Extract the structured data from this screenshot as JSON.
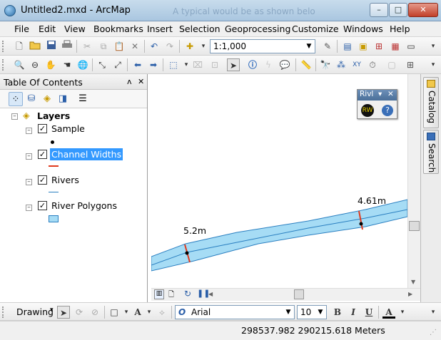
{
  "window": {
    "title": "Untitled2.mxd - ArcMap",
    "background_text": "A typical would be as shown belo",
    "minimize": "–",
    "maximize": "□",
    "close": "✕"
  },
  "menu": [
    "File",
    "Edit",
    "View",
    "Bookmarks",
    "Insert",
    "Selection",
    "Geoprocessing",
    "Customize",
    "Windows",
    "Help"
  ],
  "standard_toolbar": {
    "scale": "1:1,000"
  },
  "toc": {
    "title": "Table Of Contents",
    "pin": "ᴧ",
    "close": "✕",
    "root": "Layers",
    "layers": [
      {
        "name": "Sample",
        "checked": true,
        "symbol": "point"
      },
      {
        "name": "Channel Widths",
        "checked": true,
        "symbol": "line-red",
        "selected": true
      },
      {
        "name": "Rivers",
        "checked": true,
        "symbol": "line-blue"
      },
      {
        "name": "River Polygons",
        "checked": true,
        "symbol": "polygon"
      }
    ]
  },
  "map": {
    "labels": [
      {
        "text": "5.2m"
      },
      {
        "text": "4.61m"
      }
    ],
    "colors": {
      "river_fill": "#a6dcf5",
      "river_outline": "#2a7fc0",
      "centerline": "#2a7fc0",
      "width_line": "#e03a1e"
    }
  },
  "floating_toolbar": {
    "title": "Rivl",
    "dropdown": "▾",
    "close": "✕"
  },
  "right_dock": {
    "tabs": [
      "Catalog",
      "Search"
    ]
  },
  "drawing": {
    "label": "Drawing",
    "font": "Arial",
    "size": "10",
    "bold": "B",
    "italic": "I",
    "underline": "U",
    "font_color": "A"
  },
  "status": {
    "coords": "298537.982  290215.618 Meters"
  }
}
